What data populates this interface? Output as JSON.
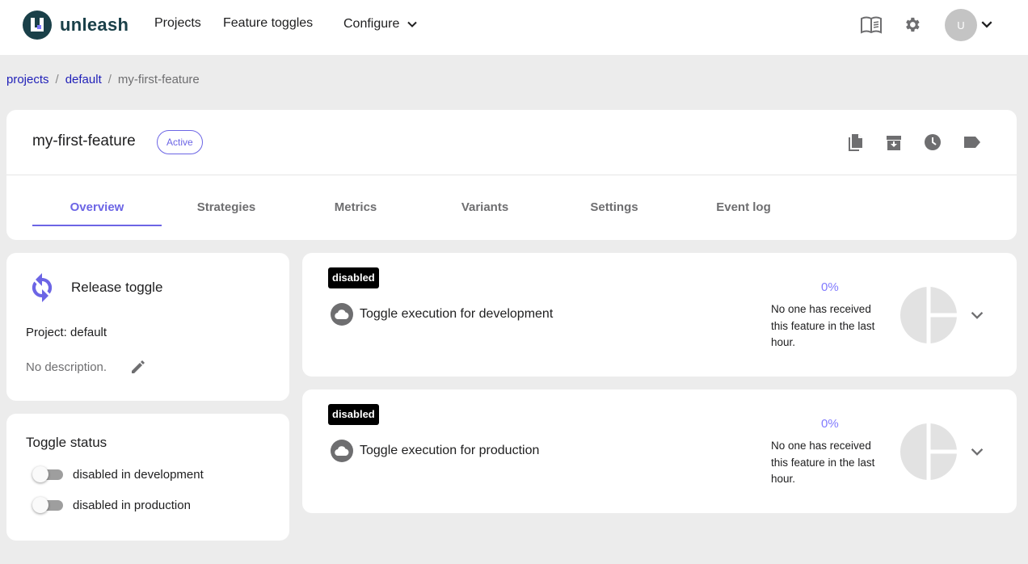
{
  "header": {
    "logo_text": "unleash",
    "nav": {
      "projects": "Projects",
      "feature_toggles": "Feature toggles",
      "configure": "Configure"
    },
    "icons": [
      "documentation-book-icon",
      "settings-gear-icon"
    ],
    "avatar_initial": "U"
  },
  "breadcrumb": {
    "items": [
      "projects",
      "default"
    ],
    "current": "my-first-feature",
    "separator": "/"
  },
  "feature": {
    "name": "my-first-feature",
    "status": "Active",
    "actions": [
      "copy-icon",
      "archive-icon",
      "history-clock-icon",
      "tag-icon"
    ],
    "tabs": [
      "Overview",
      "Strategies",
      "Metrics",
      "Variants",
      "Settings",
      "Event log"
    ],
    "active_tab": "Overview"
  },
  "info_panel": {
    "type_label": "Release toggle",
    "project_line": "Project: default",
    "description": "No description."
  },
  "toggle_status": {
    "title": "Toggle status",
    "items": [
      {
        "label": "disabled in development",
        "enabled": false
      },
      {
        "label": "disabled in production",
        "enabled": false
      }
    ]
  },
  "environments": [
    {
      "badge": "disabled",
      "name": "Toggle execution for development",
      "percent": "0%",
      "info": "No one has received this feature in the last hour."
    },
    {
      "badge": "disabled",
      "name": "Toggle execution for production",
      "percent": "0%",
      "info": "No one has received this feature in the last hour."
    }
  ],
  "colors": {
    "primary": "#6c65e5",
    "accent": "#817afe",
    "link": "#1f1fb8",
    "logo": "#1a4049",
    "background": "#ececec"
  }
}
